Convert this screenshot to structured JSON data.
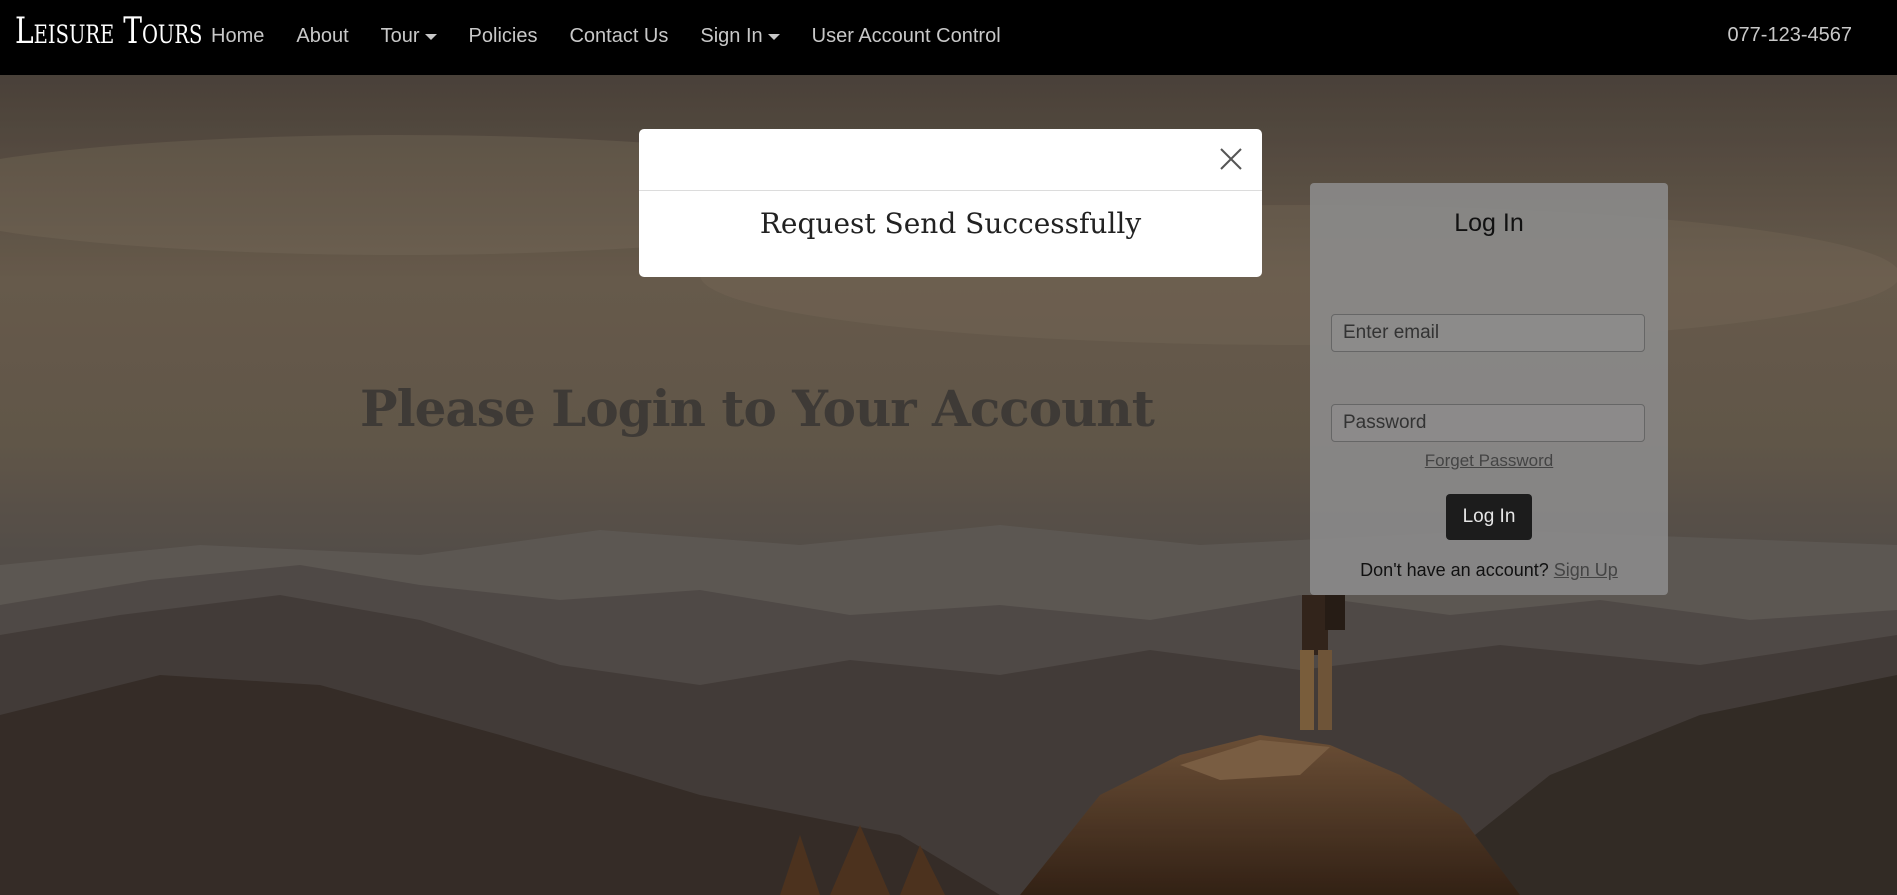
{
  "nav": {
    "brand": "Leisure Tours",
    "links": [
      {
        "label": "Home",
        "dropdown": false
      },
      {
        "label": "About",
        "dropdown": false
      },
      {
        "label": "Tour",
        "dropdown": true
      },
      {
        "label": "Policies",
        "dropdown": false
      },
      {
        "label": "Contact Us",
        "dropdown": false
      },
      {
        "label": "Sign In",
        "dropdown": true
      },
      {
        "label": "User Account Control",
        "dropdown": false
      }
    ],
    "phone": "077-123-4567"
  },
  "hero": {
    "title": "Please Login to Your Account"
  },
  "login": {
    "title": "Log In",
    "email_placeholder": "Enter email",
    "password_placeholder": "Password",
    "forget_label": "Forget Password",
    "button_label": "Log In",
    "signup_prompt": "Don't have an account?",
    "signup_link": "Sign Up"
  },
  "modal": {
    "message": "Request Send Successfully",
    "close_icon": "close-icon"
  }
}
